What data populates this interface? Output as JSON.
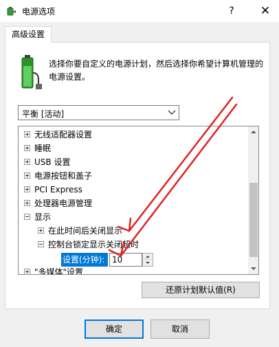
{
  "window": {
    "title": "电源选项",
    "help_glyph": "?",
    "close_glyph": "✕"
  },
  "tabs": [
    {
      "label": "高级设置"
    }
  ],
  "description": "选择你要自定义的电源计划，然后选择你希望计算机管理的电源设置。",
  "plan_select": {
    "value": "平衡 [活动]",
    "options": []
  },
  "tree": {
    "items": [
      {
        "label": "无线适配器设置",
        "expander": "+"
      },
      {
        "label": "睡眠",
        "expander": "+"
      },
      {
        "label": "USB 设置",
        "expander": "+"
      },
      {
        "label": "电源按钮和盖子",
        "expander": "+"
      },
      {
        "label": "PCI Express",
        "expander": "+"
      },
      {
        "label": "处理器电源管理",
        "expander": "+"
      },
      {
        "label": "显示",
        "expander": "-"
      },
      {
        "label": "在此时间后关闭显示",
        "expander": "+"
      },
      {
        "label": "控制台锁定显示关闭超时",
        "expander": "-"
      },
      {
        "label": "\"多媒体\"设置",
        "expander": "+"
      }
    ],
    "setting": {
      "label": "设置(分钟):",
      "value": "10"
    }
  },
  "buttons": {
    "restore": "还原计划默认值(R)",
    "ok": "确定",
    "cancel": "取消"
  },
  "colors": {
    "accent": "#0078d7",
    "annotation_arrow": "#e02020"
  },
  "icons": [
    "battery-plug-icon",
    "help-icon",
    "close-icon",
    "chevron-down-icon",
    "expand-icon",
    "collapse-icon",
    "spin-up-icon",
    "spin-down-icon",
    "scroll-up-icon",
    "scroll-down-icon",
    "arrow-annotation"
  ]
}
